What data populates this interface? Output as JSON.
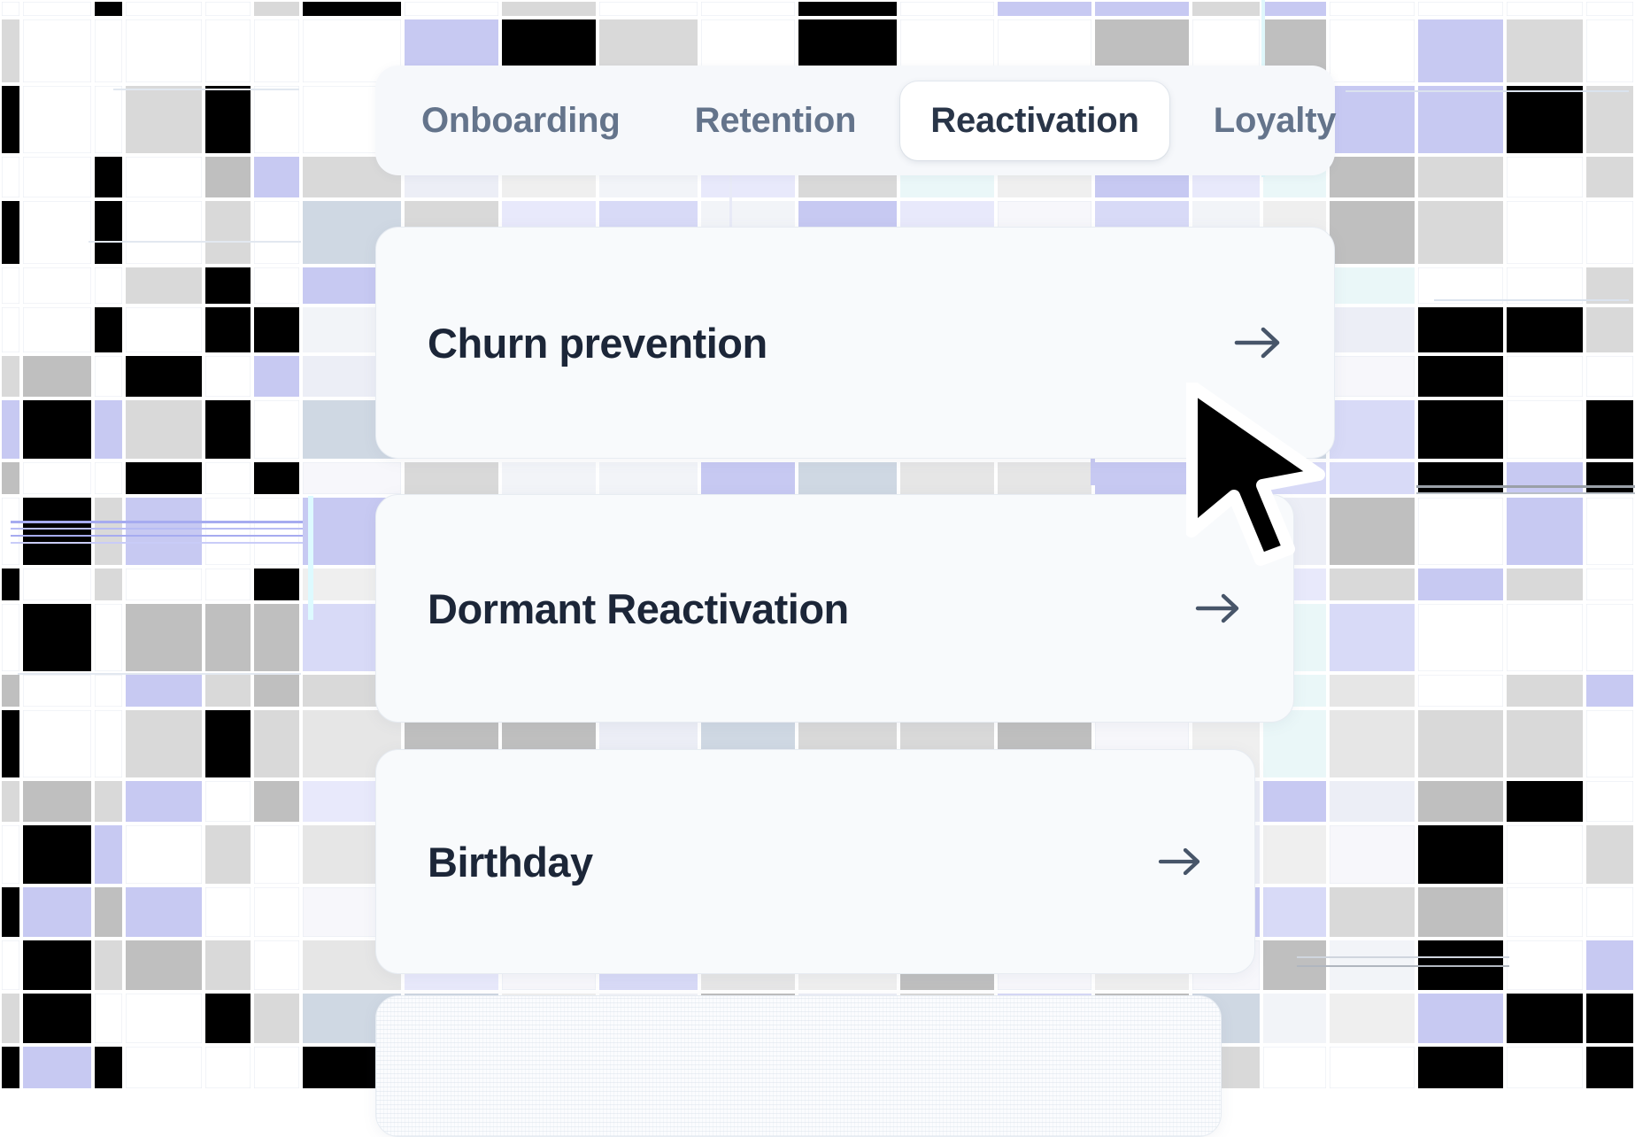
{
  "tabs": {
    "items": [
      {
        "label": "Onboarding",
        "active": false
      },
      {
        "label": "Retention",
        "active": false
      },
      {
        "label": "Reactivation",
        "active": true
      },
      {
        "label": "Loyalty",
        "active": false
      }
    ]
  },
  "cards": [
    {
      "title": "Churn prevention",
      "arrow_icon": "arrow-right-icon"
    },
    {
      "title": "Dormant Reactivation",
      "arrow_icon": "arrow-right-icon"
    },
    {
      "title": "Birthday",
      "arrow_icon": "arrow-right-icon"
    },
    {
      "title": "",
      "arrow_icon": "arrow-right-icon"
    }
  ],
  "cursor": {
    "icon": "mouse-pointer-icon"
  },
  "colors": {
    "tabbar_bg": "#f6f8fb",
    "tab_inactive_text": "#64748b",
    "tab_active_text": "#293548",
    "tab_active_bg": "#ffffff",
    "card_bg": "#f8fafc",
    "card_border": "#e7ecf2",
    "card_title_text": "#1c2638",
    "arrow_color": "#475569",
    "accent_lavender": "#c3c6f5",
    "page_bg": "#ffffff"
  }
}
